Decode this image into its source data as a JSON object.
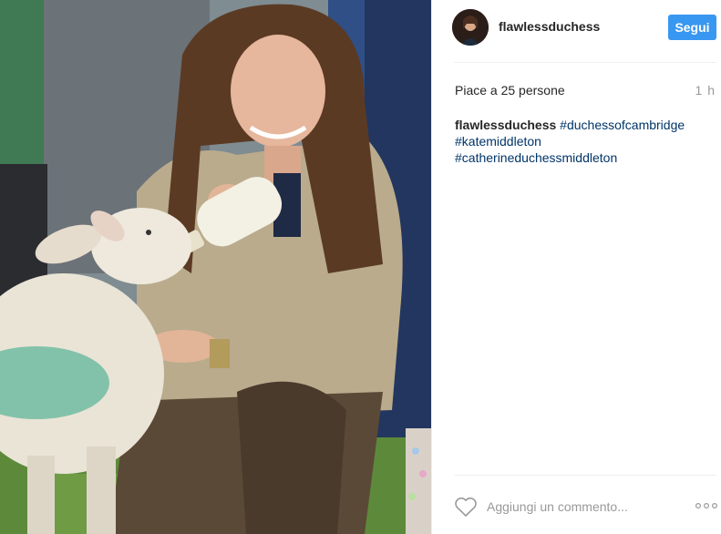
{
  "post": {
    "username": "flawlessduchess",
    "follow_label": "Segui",
    "likes_text": "Piace a 25 persone",
    "time_ago": "1 h",
    "caption": {
      "username": "flawlessduchess",
      "hashtags": [
        "#duchessofcambridge",
        "#katemiddleton",
        "#catherineduchessmiddleton"
      ]
    },
    "comment_placeholder": "Aggiungi un commento..."
  },
  "icons": {
    "like": "heart-outline-icon",
    "more": "more-options-icon"
  },
  "colors": {
    "follow_button": "#3897f0",
    "hashtag": "#003569",
    "muted_text": "#999999",
    "divider": "#efefef"
  }
}
